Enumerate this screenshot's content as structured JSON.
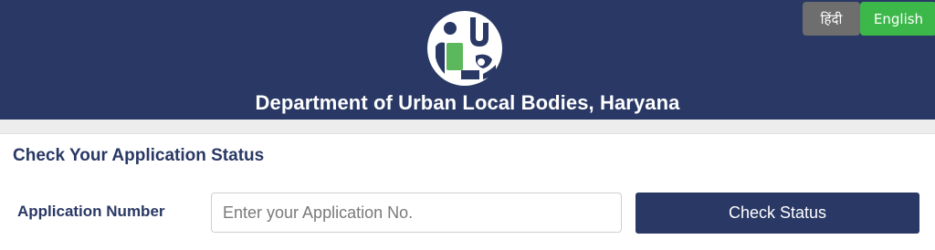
{
  "header": {
    "title": "Department of Urban Local Bodies, Haryana",
    "logo_icon": "ulb-logo-icon"
  },
  "language": {
    "hindi_label": "हिंदी",
    "english_label": "English"
  },
  "status_check": {
    "heading": "Check Your Application Status",
    "field_label": "Application Number",
    "input_value": "",
    "input_placeholder": "Enter your Application No.",
    "button_label": "Check Status"
  },
  "colors": {
    "header_bg": "#293865",
    "english_active": "#3cb84a",
    "hindi_inactive": "#6e6e6e",
    "logo_accent": "#5cb85c"
  }
}
